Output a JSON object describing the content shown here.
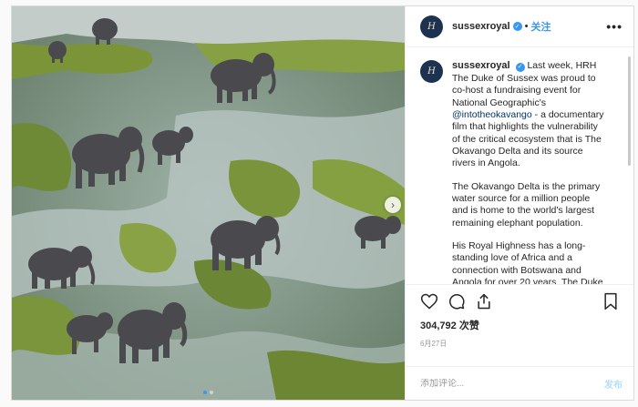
{
  "post": {
    "username": "sussexroyal",
    "follow_label": "关注",
    "separator": "•",
    "more_label": "•••",
    "avatar_mark": "H",
    "caption": {
      "username": "sussexroyal",
      "paragraphs": [
        "Last week, HRH The Duke of Sussex was proud to co-host a fundraising event for National Geographic's",
        "The Okavango Delta is the primary water source for a million people and is home to the world's largest remaining elephant population.",
        "His Royal Highness has a long-standing love of Africa and a connection with Botswana and Angola for over 20 years. The Duke is grateful to see National Geographic partnering with the Angolan"
      ],
      "mention": "@intotheokavango",
      "paragraph1_tail": " - a documentary film that highlights the vulnerability of the critical ecosystem that is The Okavango Delta and its source rivers in Angola."
    },
    "likes": "304,792 次赞",
    "date": "6月27日",
    "comment_placeholder": "添加评论...",
    "post_button": "发布",
    "carousel": {
      "total": 2,
      "active": 1
    }
  },
  "icons": {
    "like": "heart-icon",
    "comment": "comment-icon",
    "share": "share-icon",
    "save": "bookmark-icon",
    "verified": "verified-badge-icon",
    "next": "chevron-right-icon"
  },
  "colors": {
    "accent": "#3897f0",
    "avatar_bg": "#1d3250",
    "border": "#dbdbdb"
  }
}
